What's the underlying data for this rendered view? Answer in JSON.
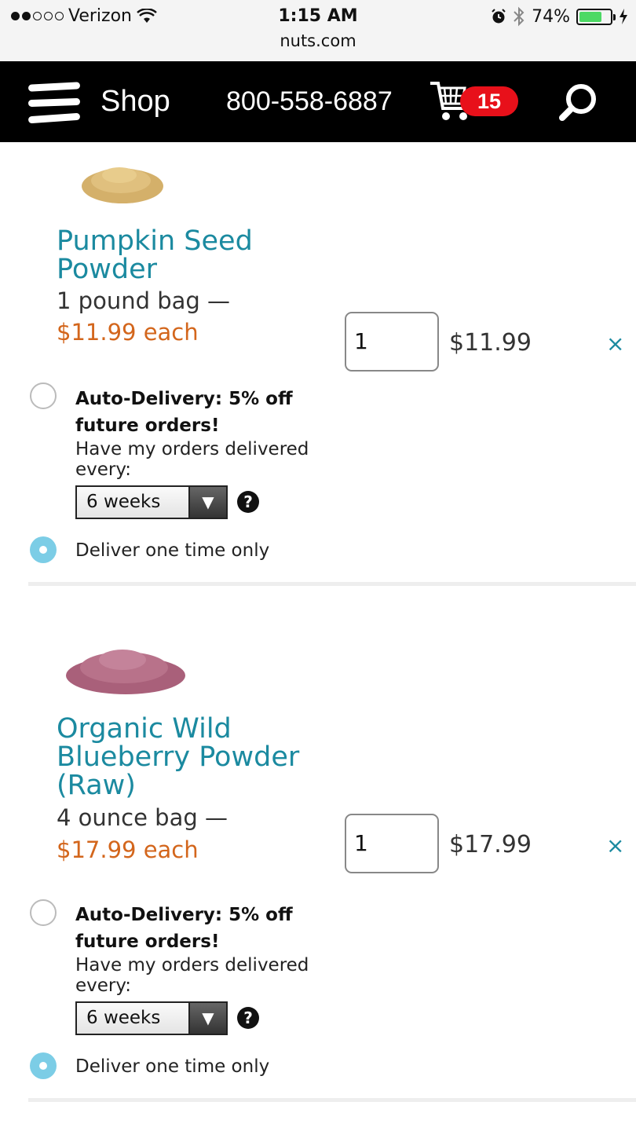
{
  "status_bar": {
    "carrier": "Verizon",
    "time": "1:15 AM",
    "url": "nuts.com",
    "battery": "74%",
    "battery_level": 0.74,
    "icons": [
      "signal-dots-icon",
      "wifi-icon",
      "alarm-icon",
      "bluetooth-icon",
      "battery-icon",
      "charging-icon"
    ]
  },
  "header": {
    "shop_label": "Shop",
    "phone": "800-558-6887",
    "cart_count": "15",
    "badge_color": "#e8101a",
    "icons": [
      "menu-icon",
      "cart-icon",
      "search-icon"
    ]
  },
  "items": [
    {
      "name": "Pumpkin Seed Powder",
      "size": "1 pound bag —",
      "unit_price": "$11.99 each",
      "quantity": "1",
      "line_total": "$11.99",
      "remove": "×",
      "auto_delivery": {
        "title": "Auto-Delivery: 5% off future orders!",
        "subtitle": "Have my orders delivered every:",
        "frequency": "6 weeks",
        "selected": false
      },
      "one_time": {
        "label": "Deliver one time only",
        "selected": true
      }
    },
    {
      "name": "Organic Wild Blueberry Powder (Raw)",
      "size": "4 ounce bag —",
      "unit_price": "$17.99 each",
      "quantity": "1",
      "line_total": "$17.99",
      "remove": "×",
      "auto_delivery": {
        "title": "Auto-Delivery: 5% off future orders!",
        "subtitle": "Have my orders delivered every:",
        "frequency": "6 weeks",
        "selected": false
      },
      "one_time": {
        "label": "Deliver one time only",
        "selected": true
      }
    }
  ],
  "colors": {
    "link": "#1b8aa0",
    "price": "#d3661c",
    "header_bg": "#000000",
    "radio_selected": "#7ccde6"
  }
}
